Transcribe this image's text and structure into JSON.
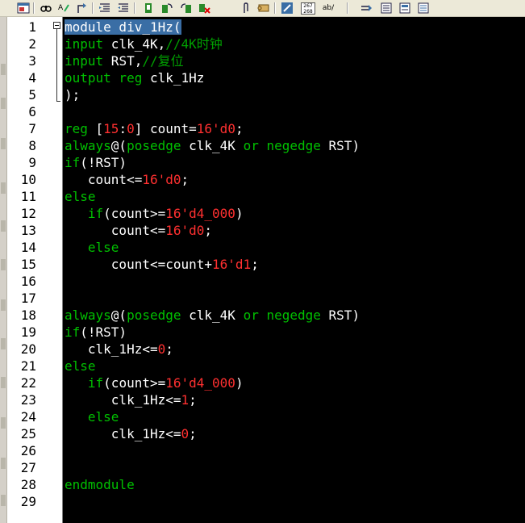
{
  "toolbar": {
    "buttons": [
      "window-icon",
      "find-icon",
      "find-replace-icon",
      "goto-icon",
      "indent-icon",
      "outdent-icon",
      "bookmark-icon",
      "bookmark-next-icon",
      "bookmark-prev-icon",
      "bookmark-clear-icon",
      "paperclip-icon",
      "scroll-icon",
      "edit-icon",
      "line-numbers-icon",
      "wordwrap-icon",
      "arrow-icon",
      "block-icon",
      "block2-icon",
      "block3-icon"
    ],
    "line_numbers_label": "267\n268",
    "wordwrap_label": "ab/"
  },
  "colors": {
    "keyword": "#00c000",
    "number": "#ff3030",
    "comment": "#00a000",
    "text": "#ffffff",
    "background": "#000000"
  },
  "lines": [
    [
      {
        "t": "module div_1Hz(",
        "c": "sel"
      }
    ],
    [
      {
        "t": "input",
        "c": "kw"
      },
      {
        "t": " clk_4K,",
        "c": "op"
      },
      {
        "t": "//4K时钟",
        "c": "cm"
      }
    ],
    [
      {
        "t": "input",
        "c": "kw"
      },
      {
        "t": " RST,",
        "c": "op"
      },
      {
        "t": "//复位",
        "c": "cm"
      }
    ],
    [
      {
        "t": "output reg",
        "c": "kw"
      },
      {
        "t": " clk_1Hz",
        "c": "op"
      }
    ],
    [
      {
        "t": ");",
        "c": "op"
      }
    ],
    [],
    [
      {
        "t": "reg",
        "c": "kw"
      },
      {
        "t": " [",
        "c": "op"
      },
      {
        "t": "15",
        "c": "num"
      },
      {
        "t": ":",
        "c": "op"
      },
      {
        "t": "0",
        "c": "num"
      },
      {
        "t": "] count=",
        "c": "op"
      },
      {
        "t": "16'd0",
        "c": "num"
      },
      {
        "t": ";",
        "c": "op"
      }
    ],
    [
      {
        "t": "always",
        "c": "kw"
      },
      {
        "t": "@(",
        "c": "op"
      },
      {
        "t": "posedge",
        "c": "kw"
      },
      {
        "t": " clk_4K ",
        "c": "op"
      },
      {
        "t": "or",
        "c": "kw"
      },
      {
        "t": " ",
        "c": "op"
      },
      {
        "t": "negedge",
        "c": "kw"
      },
      {
        "t": " RST)",
        "c": "op"
      }
    ],
    [
      {
        "t": "if",
        "c": "kw"
      },
      {
        "t": "(!RST)",
        "c": "op"
      }
    ],
    [
      {
        "t": "   count<=",
        "c": "op"
      },
      {
        "t": "16'd0",
        "c": "num"
      },
      {
        "t": ";",
        "c": "op"
      }
    ],
    [
      {
        "t": "else",
        "c": "kw"
      }
    ],
    [
      {
        "t": "   ",
        "c": "op"
      },
      {
        "t": "if",
        "c": "kw"
      },
      {
        "t": "(count>=",
        "c": "op"
      },
      {
        "t": "16'd4_000",
        "c": "num"
      },
      {
        "t": ")",
        "c": "op"
      }
    ],
    [
      {
        "t": "      count<=",
        "c": "op"
      },
      {
        "t": "16'd0",
        "c": "num"
      },
      {
        "t": ";",
        "c": "op"
      }
    ],
    [
      {
        "t": "   ",
        "c": "op"
      },
      {
        "t": "else",
        "c": "kw"
      }
    ],
    [
      {
        "t": "      count<=count+",
        "c": "op"
      },
      {
        "t": "16'd1",
        "c": "num"
      },
      {
        "t": ";",
        "c": "op"
      }
    ],
    [],
    [],
    [
      {
        "t": "always",
        "c": "kw"
      },
      {
        "t": "@(",
        "c": "op"
      },
      {
        "t": "posedge",
        "c": "kw"
      },
      {
        "t": " clk_4K ",
        "c": "op"
      },
      {
        "t": "or",
        "c": "kw"
      },
      {
        "t": " ",
        "c": "op"
      },
      {
        "t": "negedge",
        "c": "kw"
      },
      {
        "t": " RST)",
        "c": "op"
      }
    ],
    [
      {
        "t": "if",
        "c": "kw"
      },
      {
        "t": "(!RST)",
        "c": "op"
      }
    ],
    [
      {
        "t": "   clk_1Hz<=",
        "c": "op"
      },
      {
        "t": "0",
        "c": "num"
      },
      {
        "t": ";",
        "c": "op"
      }
    ],
    [
      {
        "t": "else",
        "c": "kw"
      }
    ],
    [
      {
        "t": "   ",
        "c": "op"
      },
      {
        "t": "if",
        "c": "kw"
      },
      {
        "t": "(count>=",
        "c": "op"
      },
      {
        "t": "16'd4_000",
        "c": "num"
      },
      {
        "t": ")",
        "c": "op"
      }
    ],
    [
      {
        "t": "      clk_1Hz<=",
        "c": "op"
      },
      {
        "t": "1",
        "c": "num"
      },
      {
        "t": ";",
        "c": "op"
      }
    ],
    [
      {
        "t": "   ",
        "c": "op"
      },
      {
        "t": "else",
        "c": "kw"
      }
    ],
    [
      {
        "t": "      clk_1Hz<=",
        "c": "op"
      },
      {
        "t": "0",
        "c": "num"
      },
      {
        "t": ";",
        "c": "op"
      }
    ],
    [],
    [],
    [
      {
        "t": "endmodule",
        "c": "kw"
      }
    ],
    []
  ],
  "line_numbers": [
    "1",
    "2",
    "3",
    "4",
    "5",
    "6",
    "7",
    "8",
    "9",
    "10",
    "11",
    "12",
    "13",
    "14",
    "15",
    "16",
    "17",
    "18",
    "19",
    "20",
    "21",
    "22",
    "23",
    "24",
    "25",
    "26",
    "27",
    "28",
    "29"
  ]
}
